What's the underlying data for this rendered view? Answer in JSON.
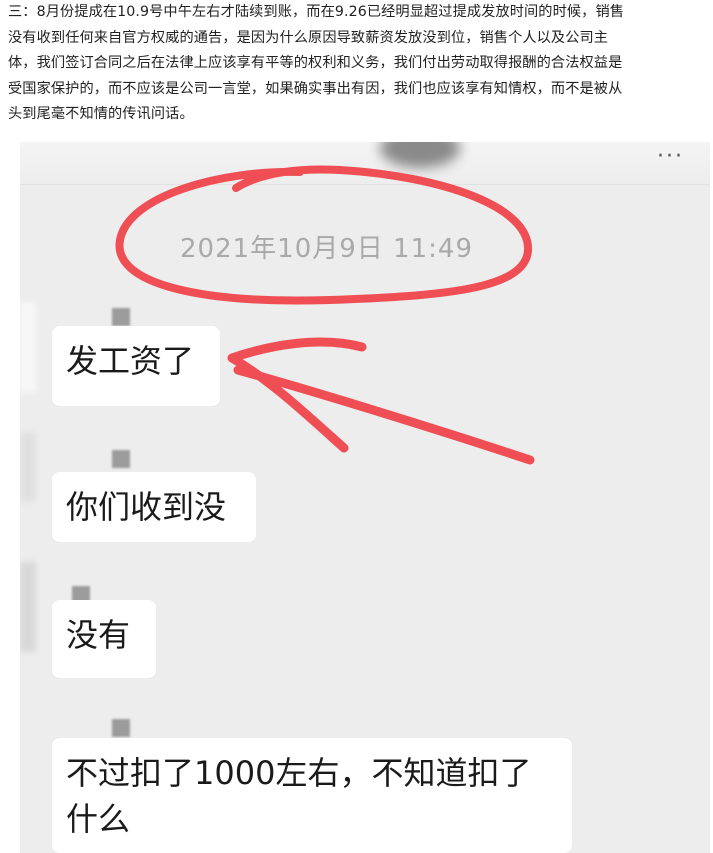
{
  "intro_text": {
    "lines": [
      "三：8月份提成在10.9号中午左右才陆续到账，而在9.26已经明显超过提成发放时间的时候，销售",
      "没有收到任何来自官方权威的通告，是因为什么原因导致薪资发放没到位，销售个人以及公司主",
      "体，我们签订合同之后在法律上应该享有平等的权利和义务，我们付出劳动取得报酬的合法权益是",
      "受国家保护的，而不应该是公司一言堂，如果确实事出有因，我们也应该享有知情权，而不是被从",
      "头到尾毫不知情的传讯问话。"
    ]
  },
  "chat": {
    "timestamp": "2021年10月9日 11:49",
    "menu_icon_text": "···",
    "messages": [
      {
        "text": "发工资了"
      },
      {
        "text": "你们收到没"
      },
      {
        "text": "没有"
      },
      {
        "line1": "不过扣了1000左右，不知道扣了",
        "line2": "什么"
      }
    ]
  },
  "colors": {
    "annotation_red": "#ef4f54",
    "chat_background": "#ededed",
    "bubble": "#ffffff",
    "timestamp_gray": "#a9a9a9"
  }
}
